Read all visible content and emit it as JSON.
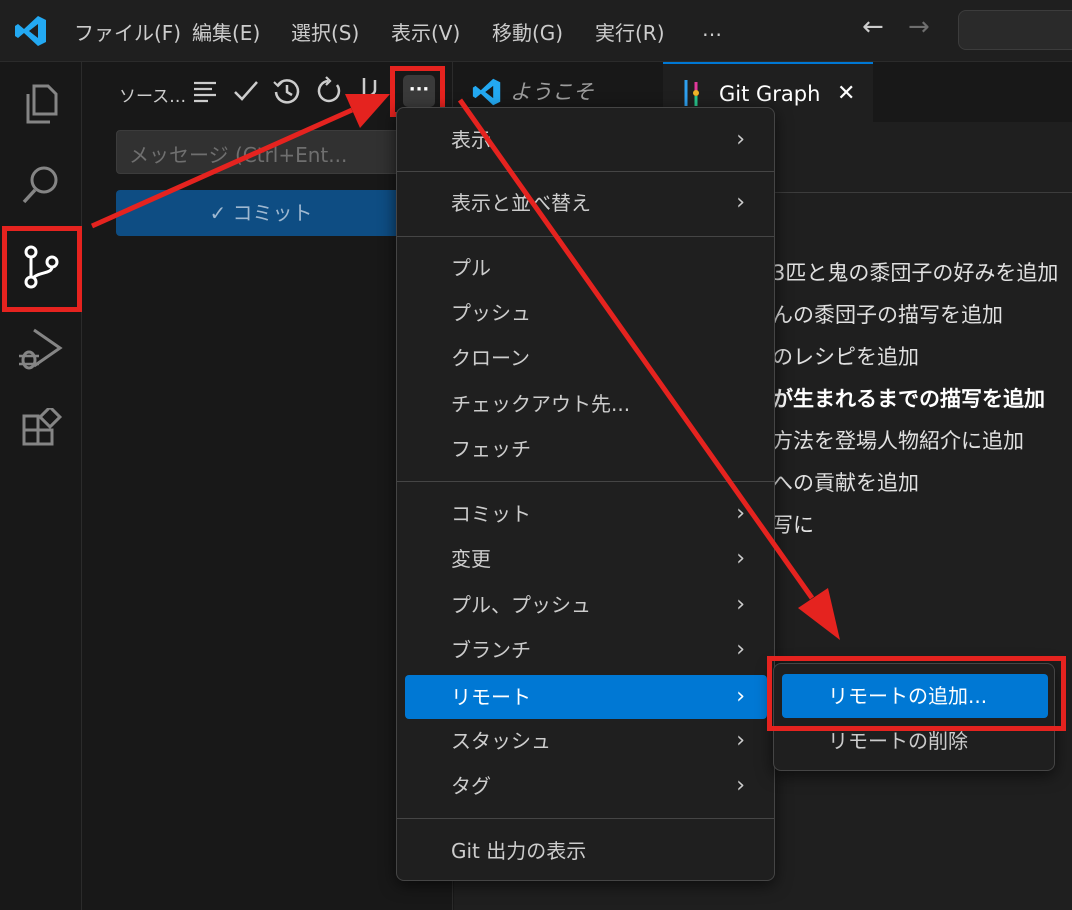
{
  "menubar": {
    "items": [
      "ファイル(F)",
      "編集(E)",
      "選択(S)",
      "表示(V)",
      "移動(G)",
      "実行(R)",
      "…"
    ],
    "back": "←",
    "forward": "→"
  },
  "sidebar": {
    "title": "ソース…",
    "message_placeholder": "メッセージ (Ctrl+Ent...",
    "commit_label": "✓ コミット",
    "more_actions": "···"
  },
  "tabs": [
    {
      "label": "ようこそ"
    },
    {
      "label": "Git Graph"
    }
  ],
  "tab_close": "✕",
  "editor": {
    "commit_messages": [
      "3匹と鬼の黍団子の好みを追加",
      "んの黍団子の描写を追加",
      "のレシピを追加",
      "が生まれるまでの描写を追加",
      "方法を登場人物紹介に追加",
      "への貢献を追加",
      "写に"
    ]
  },
  "context_menu": {
    "items": [
      {
        "label": "表示",
        "arrow": "›"
      },
      {
        "label": "表示と並べ替え",
        "arrow": "›"
      },
      {
        "label": "プル",
        "arrow": ""
      },
      {
        "label": "プッシュ",
        "arrow": ""
      },
      {
        "label": "クローン",
        "arrow": ""
      },
      {
        "label": "チェックアウト先...",
        "arrow": ""
      },
      {
        "label": "フェッチ",
        "arrow": ""
      },
      {
        "label": "コミット",
        "arrow": "›"
      },
      {
        "label": "変更",
        "arrow": "›"
      },
      {
        "label": "プル、プッシュ",
        "arrow": "›"
      },
      {
        "label": "ブランチ",
        "arrow": "›"
      },
      {
        "label": "リモート",
        "arrow": "›"
      },
      {
        "label": "スタッシュ",
        "arrow": "›"
      },
      {
        "label": "タグ",
        "arrow": "›"
      },
      {
        "label": "Git 出力の表示",
        "arrow": ""
      }
    ]
  },
  "submenu": {
    "items": [
      {
        "label": "リモートの追加..."
      },
      {
        "label": "リモートの削除"
      }
    ]
  },
  "colors": {
    "accent": "#0078d4",
    "annotation": "#e5231f",
    "vscode_blue": "#23a9f2"
  },
  "icons": [
    "vscode-logo-icon",
    "explorer-icon",
    "search-icon",
    "source-control-icon",
    "run-debug-icon",
    "extensions-icon",
    "list-icon",
    "check-icon",
    "history-icon",
    "refresh-icon",
    "git-graph-icon",
    "more-icon",
    "close-icon",
    "chevron-right-icon"
  ]
}
